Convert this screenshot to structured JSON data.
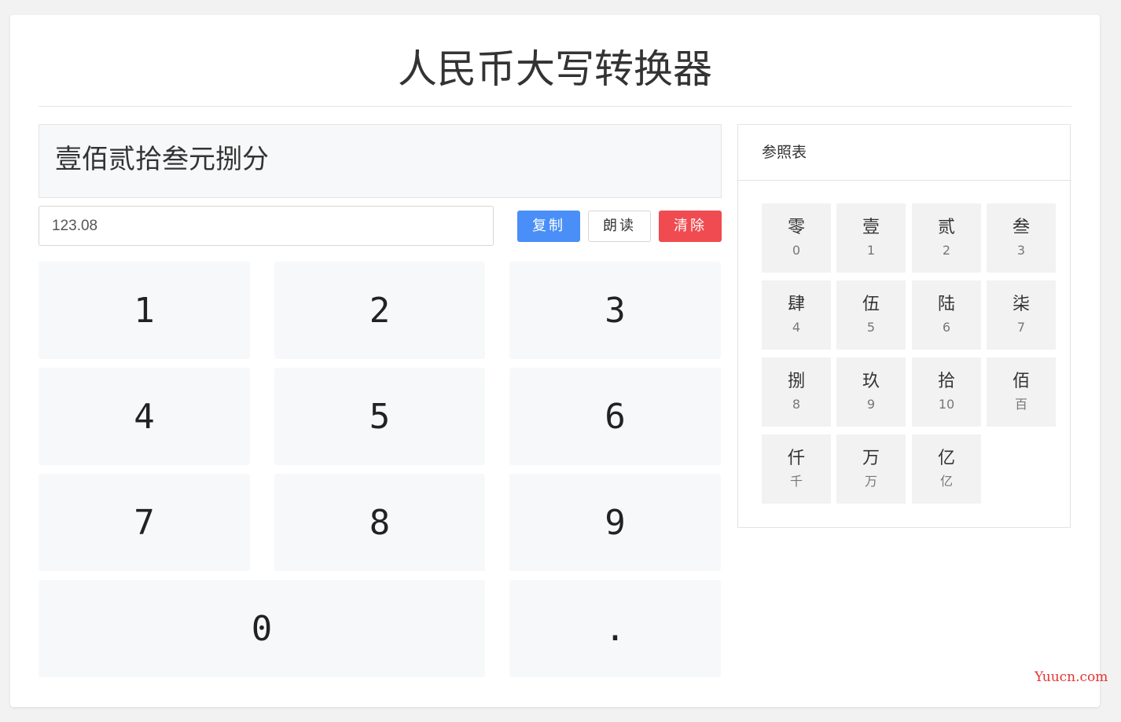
{
  "title": "人民币大写转换器",
  "result": "壹佰贰拾叁元捌分",
  "input": {
    "value": "123.08"
  },
  "buttons": {
    "copy": "复制",
    "read": "朗读",
    "clear": "清除"
  },
  "keypad": {
    "k1": "1",
    "k2": "2",
    "k3": "3",
    "k4": "4",
    "k5": "5",
    "k6": "6",
    "k7": "7",
    "k8": "8",
    "k9": "9",
    "k0": "0",
    "dot": "."
  },
  "reference": {
    "heading": "参照表",
    "items": [
      {
        "char": "零",
        "value": "0"
      },
      {
        "char": "壹",
        "value": "1"
      },
      {
        "char": "贰",
        "value": "2"
      },
      {
        "char": "叁",
        "value": "3"
      },
      {
        "char": "肆",
        "value": "4"
      },
      {
        "char": "伍",
        "value": "5"
      },
      {
        "char": "陆",
        "value": "6"
      },
      {
        "char": "柒",
        "value": "7"
      },
      {
        "char": "捌",
        "value": "8"
      },
      {
        "char": "玖",
        "value": "9"
      },
      {
        "char": "拾",
        "value": "10"
      },
      {
        "char": "佰",
        "value": "百"
      },
      {
        "char": "仟",
        "value": "千"
      },
      {
        "char": "万",
        "value": "万"
      },
      {
        "char": "亿",
        "value": "亿"
      }
    ]
  },
  "watermark": "Yuucn.com",
  "colors": {
    "copy_button": "#4a8ff7",
    "clear_button": "#ef4b50",
    "watermark": "#e53333",
    "page_background": "#f2f2f2"
  }
}
